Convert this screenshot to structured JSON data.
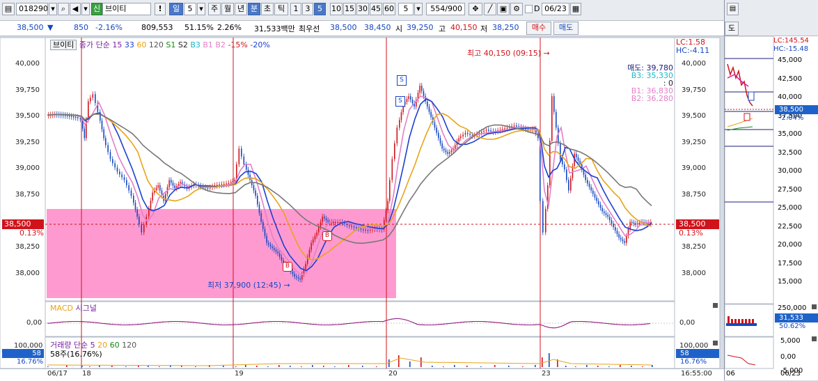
{
  "toolbar": {
    "code": "018290",
    "search_icon": "search-icon",
    "sound_icon": "speaker-icon",
    "badge": "신",
    "stock_name": "브이티",
    "alert": "!",
    "period_day": "일",
    "interval_value": "5",
    "periods": [
      "주",
      "월",
      "년",
      "분",
      "초",
      "틱"
    ],
    "minute_buttons": [
      "1",
      "3",
      "5",
      "10",
      "15",
      "30",
      "45",
      "60"
    ],
    "selected_minute": "5",
    "count_value": "5",
    "page_counter": "554/900",
    "checkbox_label": "D",
    "date": "06/23"
  },
  "quote": {
    "price": "38,500",
    "direction": "▼",
    "change": "850",
    "change_rate": "-2.16%",
    "volume": "809,553",
    "volume_ratio": "51.15%",
    "turnover_ratio": "2.26%",
    "amount": "31,533백만",
    "best_label": "최우선",
    "best_ask": "38,500",
    "best_bid": "38,450",
    "open_label": "시",
    "open": "39,250",
    "high_label": "고",
    "high": "40,150",
    "low_label": "저",
    "low": "38,250",
    "buy_button": "매수",
    "sell_button": "매도"
  },
  "main_chart": {
    "legend_name": "브이티",
    "legend_items": [
      {
        "text": "종가 단순 15",
        "color": "#7a1fa2"
      },
      {
        "text": "33",
        "color": "#1b3fcf"
      },
      {
        "text": "60",
        "color": "#e8a317"
      },
      {
        "text": "120",
        "color": "#555555"
      },
      {
        "text": "S1",
        "color": "#108a10"
      },
      {
        "text": "S2",
        "color": "#222222"
      },
      {
        "text": "B3",
        "color": "#17b8c8"
      },
      {
        "text": "B1",
        "color": "#e37fc9"
      },
      {
        "text": "B2",
        "color": "#e37fc9"
      },
      {
        "text": "-15%",
        "color": "#d0131b"
      },
      {
        "text": "-20%",
        "color": "#1b3fcf"
      }
    ],
    "lc": "LC:1.58",
    "hc": "HC:-4.11",
    "y_ticks": [
      "40,000",
      "39,750",
      "39,500",
      "39,250",
      "39,000",
      "38,750",
      "38,500",
      "38,250",
      "38,000"
    ],
    "current_price_tag": "38,500",
    "current_rate_tag": "0.13%",
    "high_annotation": "최고 40,150 (09:15)",
    "low_annotation": "최저 37,900 (12:45)",
    "right_info": [
      {
        "text": "매도: 39,780",
        "color": "#1b1b7a"
      },
      {
        "text": "B3: 35,330",
        "color": "#17b8c8"
      },
      {
        "text": ": 0",
        "color": "#222222"
      },
      {
        "text": "B1: 36,830",
        "color": "#e37fc9"
      },
      {
        "text": "B2: 36,280",
        "color": "#e37fc9"
      }
    ],
    "signal_letters": [
      "S",
      "S",
      "B",
      "B"
    ]
  },
  "chart_data": {
    "type": "candlestick",
    "title": "",
    "x_date_labels": [
      "06/17",
      "18",
      "19",
      "20",
      "23"
    ],
    "ylim": [
      37800,
      40250
    ],
    "high": 40150,
    "low": 37900,
    "last": 38500,
    "ma_periods": [
      15,
      33,
      60,
      120
    ],
    "macd": {
      "label": "MACD",
      "signal_label": "시그널",
      "y_ticks": [
        "0,00"
      ]
    },
    "volume": {
      "label": "거래량 단순",
      "periods": [
        5,
        20,
        60,
        120
      ],
      "y_ticks": [
        "100,000",
        "58"
      ],
      "note": "58주(16.76%)",
      "rate": "16.76%"
    }
  },
  "time_label": "16:55:00",
  "side_chart": {
    "lc": "LC:145.54",
    "hc": "HC:-15.48",
    "y_ticks": [
      "45,000",
      "42,500",
      "40,000",
      "37,500",
      "35,000",
      "32,500",
      "30,000",
      "27,500",
      "25,000",
      "22,500",
      "20,000",
      "17,500",
      "15,000"
    ],
    "price_tag": "38,500",
    "rate_tag": "-2.04%",
    "volume_ticks": [
      "250,000",
      "31,533",
      "50.62%"
    ],
    "macd_ticks": [
      "5,000",
      "0,00",
      "-5,000"
    ],
    "x_labels": [
      "06",
      "06/23"
    ],
    "tab_label": "도"
  },
  "colors": {
    "up": "#d0131b",
    "down": "#1447c2",
    "box": "#ff8fcb",
    "accent": "#4a78c8"
  }
}
